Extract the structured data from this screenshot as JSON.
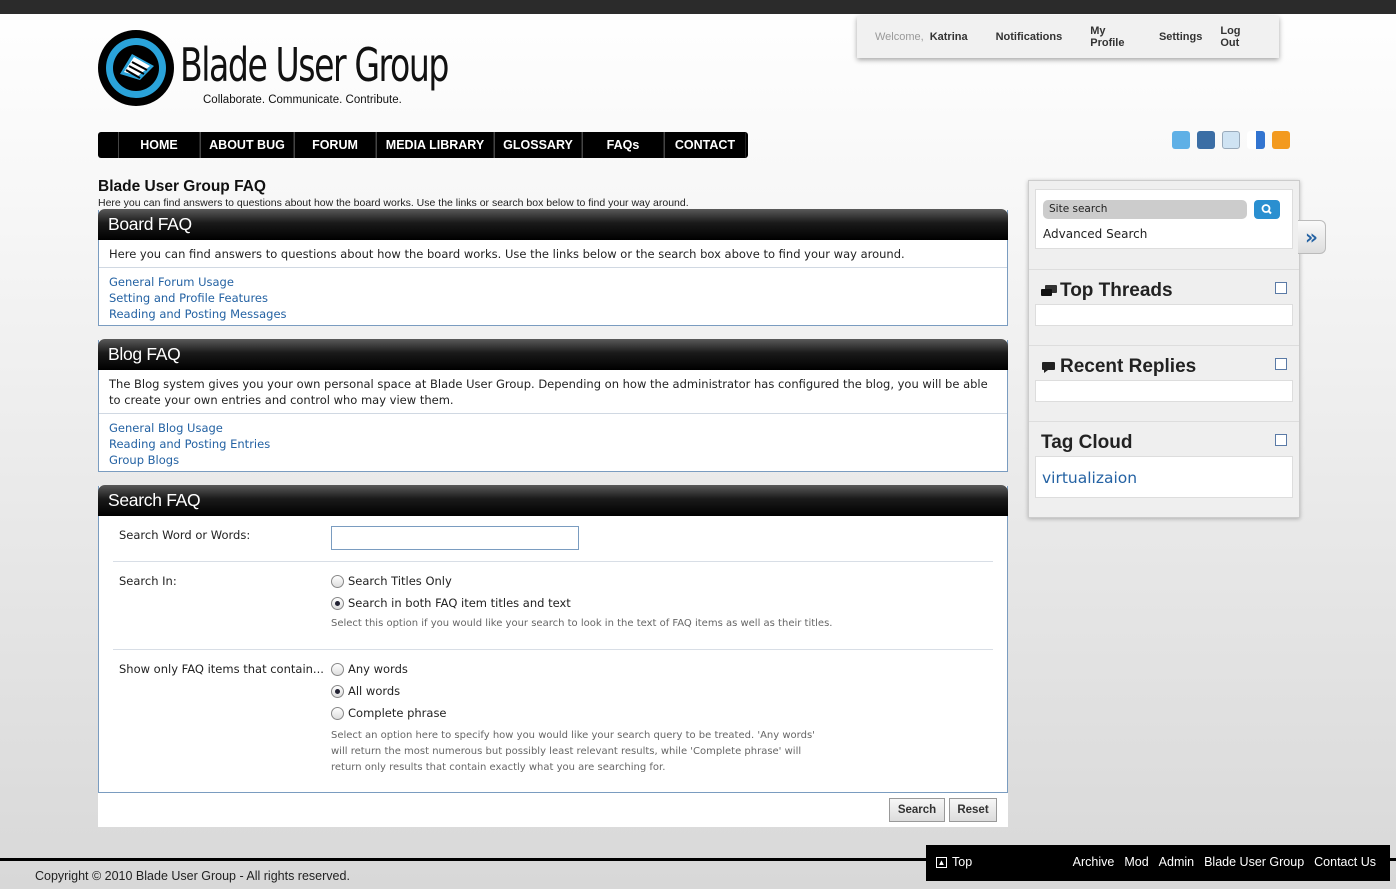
{
  "site": {
    "name": "Blade User Group",
    "tagline": "Collaborate. Communicate. Contribute."
  },
  "userpanel": {
    "welcome": "Welcome,",
    "username": "Katrina",
    "links": [
      "Notifications",
      "My Profile",
      "Settings",
      "Log Out"
    ]
  },
  "nav": [
    "HOME",
    "ABOUT BUG",
    "FORUM",
    "MEDIA LIBRARY",
    "GLOSSARY",
    "FAQs",
    "CONTACT"
  ],
  "social_icons": [
    "twitter-icon",
    "digg-icon",
    "reddit-icon",
    "delicious-icon",
    "rss-icon"
  ],
  "page": {
    "title": "Blade User Group FAQ",
    "description": "Here you can find answers to questions about how the board works. Use the links or search box below to find your way around."
  },
  "board_faq": {
    "title": "Board FAQ",
    "intro": "Here you can find answers to questions about how the board works. Use the links below or the search box above to find your way around.",
    "links": [
      "General Forum Usage",
      "Setting and Profile Features",
      "Reading and Posting Messages"
    ]
  },
  "blog_faq": {
    "title": "Blog FAQ",
    "intro": "The Blog system gives you your own personal space at Blade User Group. Depending on how the administrator has configured the blog, you will be able to create your own entries and control who may view them.",
    "links": [
      "General Blog Usage",
      "Reading and Posting Entries",
      "Group Blogs"
    ]
  },
  "search_faq": {
    "title": "Search FAQ",
    "words_label": "Search Word or Words:",
    "words_value": "",
    "search_in_label": "Search In:",
    "search_in_options": [
      "Search Titles Only",
      "Search in both FAQ item titles and text"
    ],
    "search_in_selected": 1,
    "search_in_hint": "Select this option if you would like your search to look in the text of FAQ items as well as their titles.",
    "match_label": "Show only FAQ items that contain...",
    "match_options": [
      "Any words",
      "All words",
      "Complete phrase"
    ],
    "match_selected": 1,
    "match_hint": "Select an option here to specify how you would like your search query to be treated. 'Any words' will return the most numerous but possibly least relevant results, while 'Complete phrase' will return only results that contain exactly what you are searching for.",
    "search_button": "Search",
    "reset_button": "Reset"
  },
  "sidebar": {
    "search_placeholder": "Site search",
    "advanced_search": "Advanced Search",
    "top_threads": "Top Threads",
    "recent_replies": "Recent Replies",
    "tag_cloud": "Tag Cloud",
    "tags": [
      "virtualizaion"
    ]
  },
  "footer": {
    "copyright": "Copyright © 2010 Blade User Group - All rights reserved.",
    "top": "Top",
    "links": [
      "Archive",
      "Mod",
      "Admin",
      "Blade User Group",
      "Contact Us"
    ]
  },
  "colors": {
    "link": "#2462a3",
    "accent_blue": "#2aa3da",
    "header_black": "#000000"
  }
}
